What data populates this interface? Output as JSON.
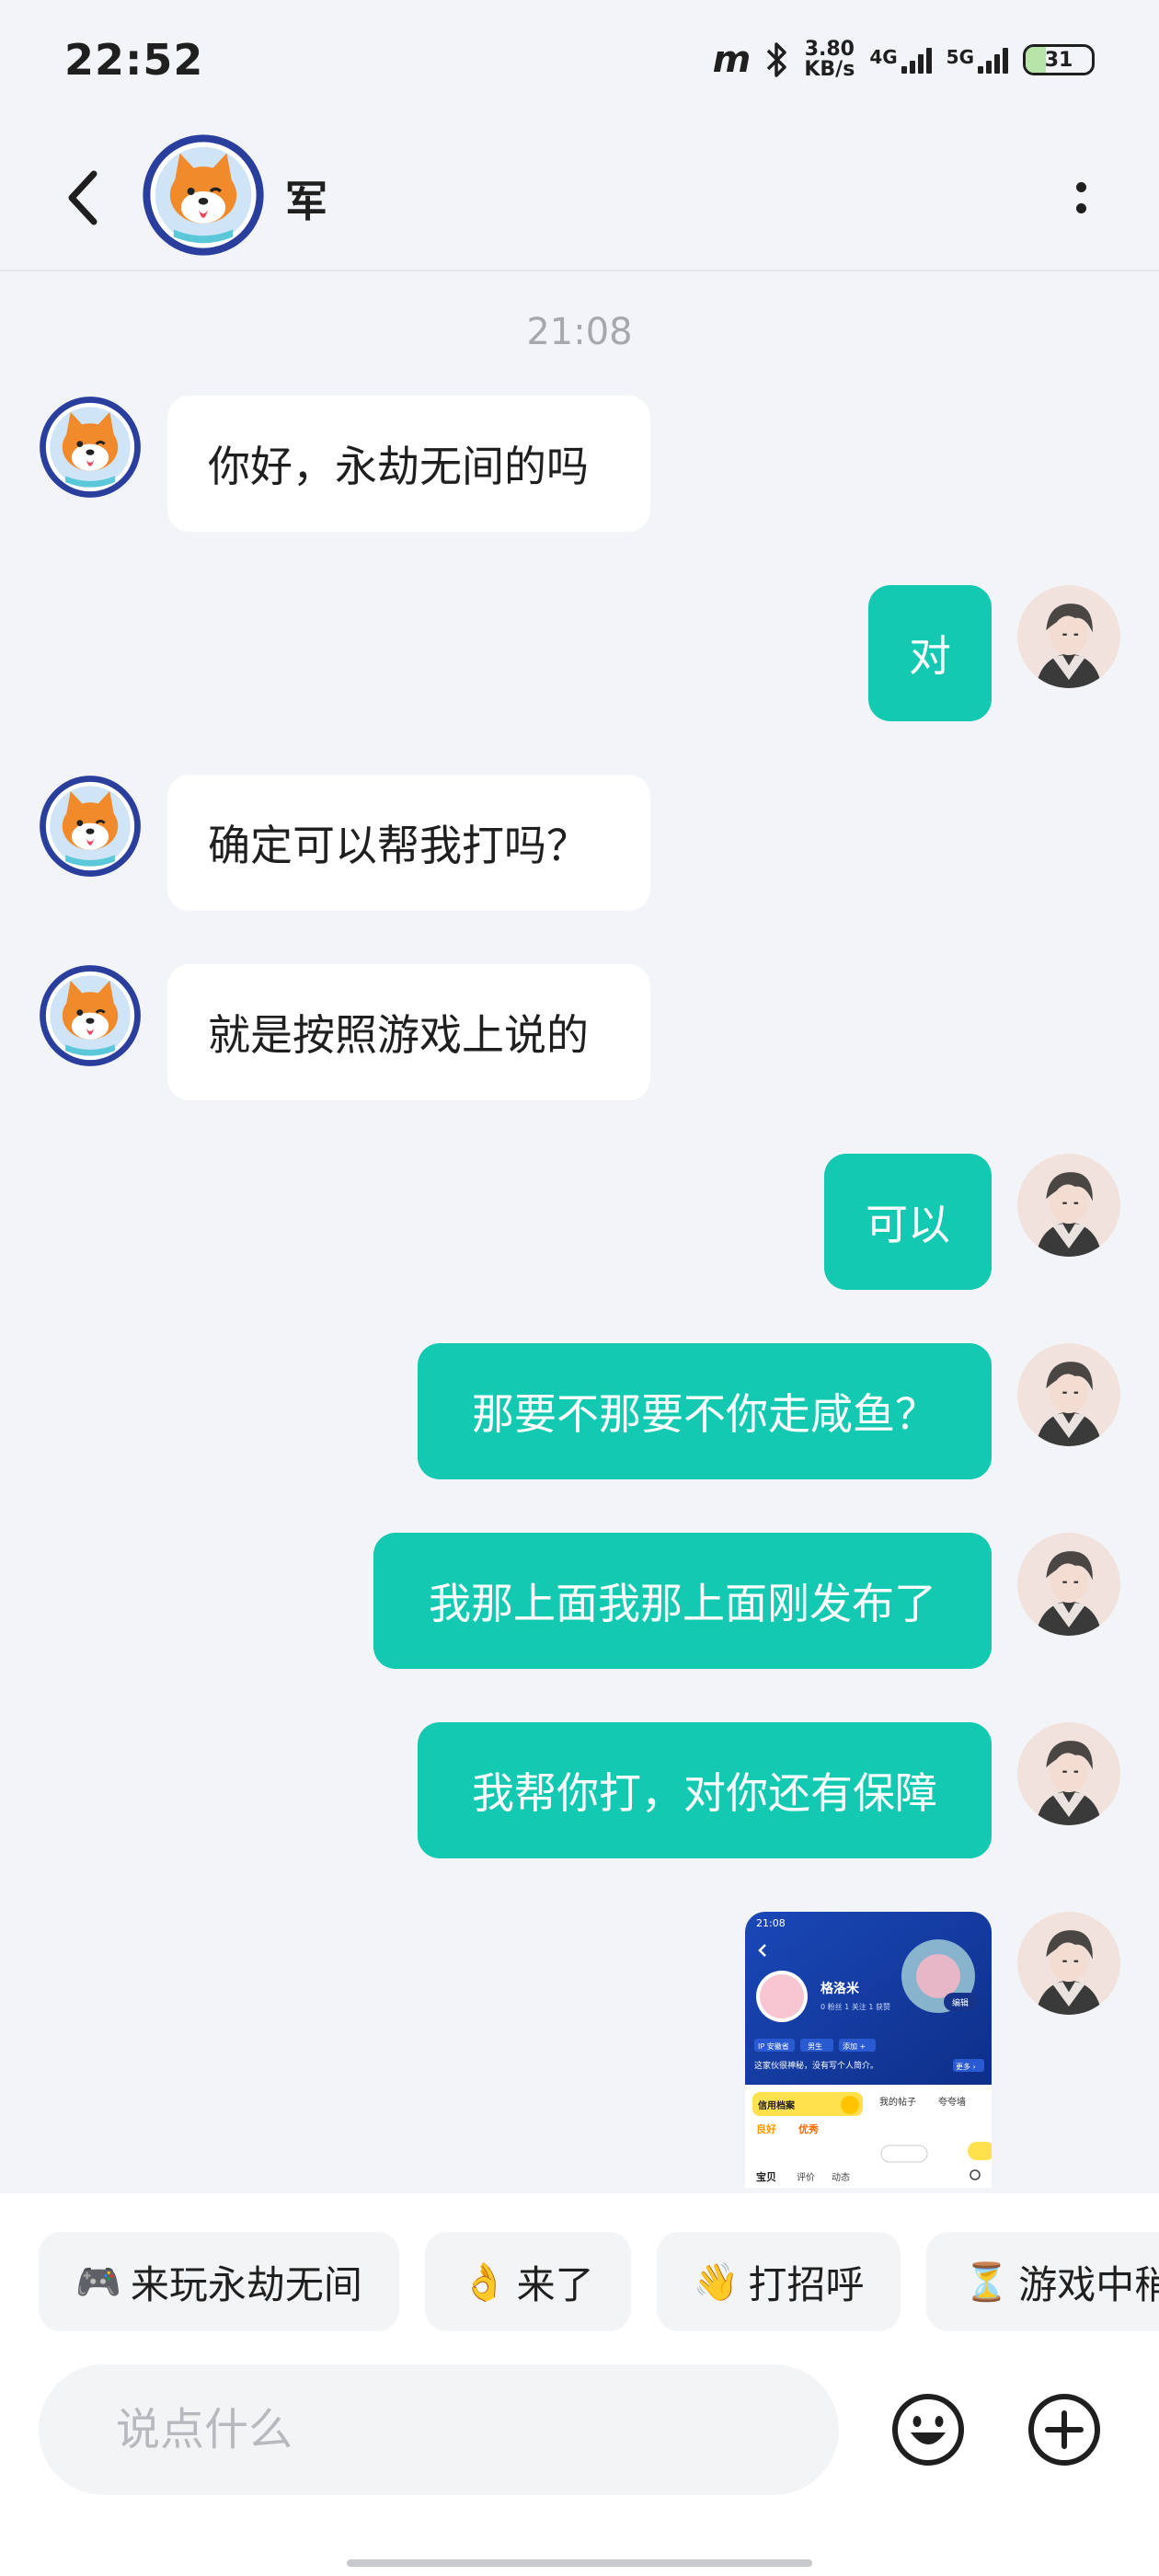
{
  "status_bar": {
    "time": "22:52",
    "carrier_glyph": "m",
    "speed_value": "3.80",
    "speed_unit": "KB/s",
    "net1": "4G",
    "net2": "5G",
    "battery": "31"
  },
  "header": {
    "name": "军"
  },
  "chat": {
    "timestamp": "21:08",
    "messages": [
      {
        "side": "in",
        "text": "你好，永劫无间的吗"
      },
      {
        "side": "out",
        "text": "对"
      },
      {
        "side": "in",
        "text": "确定可以帮我打吗？"
      },
      {
        "side": "in",
        "text": "就是按照游戏上说的"
      },
      {
        "side": "out",
        "text": "可以"
      },
      {
        "side": "out",
        "text": "那要不那要不你走咸鱼？"
      },
      {
        "side": "out",
        "text": "我那上面我那上面刚发布了"
      },
      {
        "side": "out",
        "text": "我帮你打，对你还有保障"
      }
    ],
    "image_message": {
      "time": "21:08",
      "name": "格洛米",
      "stats": "0 粉丝  1 关注  1 获赞",
      "tags": [
        "IP 安徽省",
        "男生",
        "添加 +"
      ],
      "bio": "这家伙很神秘，没有写个人简介。",
      "credit_label": "信用档案",
      "more": "更多 ›",
      "col1": "我的帖子",
      "col2": "夸夸墙",
      "rating1": "良好",
      "rating2": "优秀",
      "tabs": [
        "宝贝",
        "评价",
        "动态"
      ],
      "edit": "编辑"
    }
  },
  "quick_replies": [
    {
      "emoji": "🎮",
      "label": "来玩永劫无间"
    },
    {
      "emoji": "👌",
      "label": "来了"
    },
    {
      "emoji": "👋",
      "label": "打招呼"
    },
    {
      "emoji": "⏳",
      "label": "游戏中稍"
    }
  ],
  "input": {
    "placeholder": "说点什么"
  }
}
